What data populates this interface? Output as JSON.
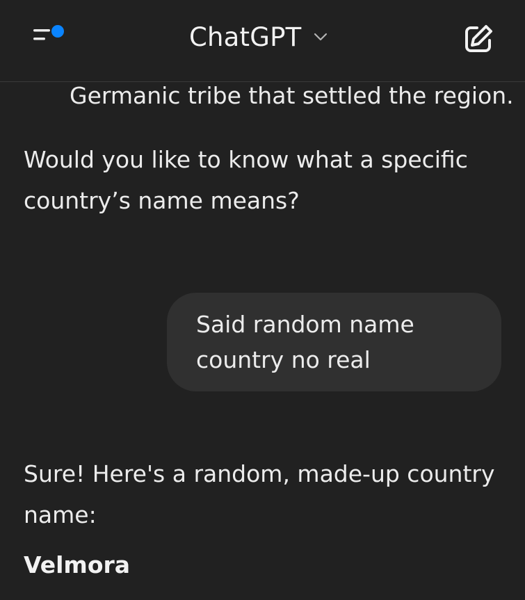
{
  "header": {
    "title": "ChatGPT",
    "menu_icon": "menu-icon",
    "new_chat_icon": "edit-icon",
    "notification_dot_color": "#0a84ff"
  },
  "conversation": {
    "assistant_prev_line": "Germanic tribe that settled the region.",
    "assistant_question": "Would you like to know what a specific country’s name means?",
    "user_message": "Said random name country no real",
    "assistant_reply_intro": "Sure! Here's a random, made-up country name:",
    "assistant_reply_name": "Velmora"
  }
}
